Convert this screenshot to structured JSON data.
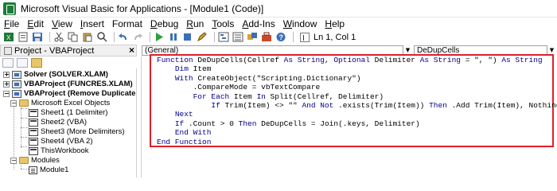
{
  "window": {
    "title": "Microsoft Visual Basic for Applications - [Module1 (Code)]",
    "accent_color": "#1f7a3a"
  },
  "menu": [
    {
      "u": "F",
      "rest": "ile"
    },
    {
      "u": "E",
      "rest": "dit"
    },
    {
      "u": "V",
      "rest": "iew"
    },
    {
      "u": "I",
      "rest": "nsert"
    },
    {
      "u": "",
      "rest": "Format"
    },
    {
      "u": "D",
      "rest": "ebug"
    },
    {
      "u": "R",
      "rest": "un"
    },
    {
      "u": "T",
      "rest": "ools"
    },
    {
      "u": "A",
      "rest": "dd-Ins"
    },
    {
      "u": "W",
      "rest": "indow"
    },
    {
      "u": "H",
      "rest": "elp"
    }
  ],
  "toolbar": {
    "icons": [
      "excel-view-icon",
      "insert-module-icon",
      "save-icon",
      "cut-icon",
      "copy-icon",
      "paste-icon",
      "find-icon",
      "undo-icon",
      "redo-icon",
      "run-icon",
      "break-icon",
      "reset-icon",
      "design-mode-icon",
      "project-explorer-icon",
      "properties-icon",
      "object-browser-icon",
      "toolbox-icon",
      "help-icon"
    ],
    "cursor_position": "Ln 1, Col 1"
  },
  "project_panel": {
    "title": "Project - VBAProject",
    "close_label": "×",
    "tree": [
      {
        "label": "Solver (SOLVER.XLAM)",
        "bold": true,
        "icon": "vbproject-icon",
        "expander": "+"
      },
      {
        "label": "VBAProject (FUNCRES.XLAM)",
        "bold": true,
        "icon": "vbproject-icon",
        "expander": "+"
      },
      {
        "label": "VBAProject (Remove Duplicate.xlsm)",
        "bold": true,
        "icon": "vbproject-icon",
        "expander": "−"
      },
      {
        "label": "Microsoft Excel Objects",
        "bold": false,
        "icon": "folder-icon",
        "expander": "−"
      },
      {
        "label": "Sheet1 (1 Delimiter)",
        "bold": false,
        "icon": "sheet-icon",
        "expander": ""
      },
      {
        "label": "Sheet2 (VBA)",
        "bold": false,
        "icon": "sheet-icon",
        "expander": ""
      },
      {
        "label": "Sheet3 (More Delimiters)",
        "bold": false,
        "icon": "sheet-icon",
        "expander": ""
      },
      {
        "label": "Sheet4 (VBA 2)",
        "bold": false,
        "icon": "sheet-icon",
        "expander": ""
      },
      {
        "label": "ThisWorkbook",
        "bold": false,
        "icon": "workbook-icon",
        "expander": ""
      },
      {
        "label": "Modules",
        "bold": false,
        "icon": "folder-icon",
        "expander": "−"
      },
      {
        "label": "Module1",
        "bold": false,
        "icon": "module-icon",
        "expander": ""
      }
    ]
  },
  "code_pane": {
    "object_combo": "(General)",
    "procedure_combo": "DeDupCells",
    "highlight_color": "#e0202a",
    "lines": [
      [
        {
          "k": true,
          "t": "Function "
        },
        {
          "k": false,
          "t": "DeDupCells(Cellref "
        },
        {
          "k": true,
          "t": "As String"
        },
        {
          "k": false,
          "t": ", "
        },
        {
          "k": true,
          "t": "Optional "
        },
        {
          "k": false,
          "t": "Delimiter "
        },
        {
          "k": true,
          "t": "As String"
        },
        {
          "k": false,
          "t": " = \", \") "
        },
        {
          "k": true,
          "t": "As String"
        }
      ],
      [
        {
          "k": false,
          "t": "    "
        },
        {
          "k": true,
          "t": "Dim "
        },
        {
          "k": false,
          "t": "Item"
        }
      ],
      [
        {
          "k": false,
          "t": "    "
        },
        {
          "k": true,
          "t": "With "
        },
        {
          "k": false,
          "t": "CreateObject(\"Scripting.Dictionary\")"
        }
      ],
      [
        {
          "k": false,
          "t": "        .CompareMode = vbTextCompare"
        }
      ],
      [
        {
          "k": false,
          "t": "        "
        },
        {
          "k": true,
          "t": "For Each "
        },
        {
          "k": false,
          "t": "Item "
        },
        {
          "k": true,
          "t": "In "
        },
        {
          "k": false,
          "t": "Split(Cellref, Delimiter)"
        }
      ],
      [
        {
          "k": false,
          "t": "            "
        },
        {
          "k": true,
          "t": "If "
        },
        {
          "k": false,
          "t": "Trim(Item) <> \"\" "
        },
        {
          "k": true,
          "t": "And Not "
        },
        {
          "k": false,
          "t": ".exists(Trim(Item)) "
        },
        {
          "k": true,
          "t": "Then "
        },
        {
          "k": false,
          "t": ".Add Trim(Item), Nothing"
        }
      ],
      [
        {
          "k": false,
          "t": "    "
        },
        {
          "k": true,
          "t": "Next"
        }
      ],
      [
        {
          "k": false,
          "t": "    "
        },
        {
          "k": true,
          "t": "If "
        },
        {
          "k": false,
          "t": ".Count > 0 "
        },
        {
          "k": true,
          "t": "Then "
        },
        {
          "k": false,
          "t": "DeDupCells = Join(.keys, Delimiter)"
        }
      ],
      [
        {
          "k": false,
          "t": "    "
        },
        {
          "k": true,
          "t": "End With"
        }
      ],
      [
        {
          "k": true,
          "t": "End Function"
        }
      ]
    ]
  }
}
